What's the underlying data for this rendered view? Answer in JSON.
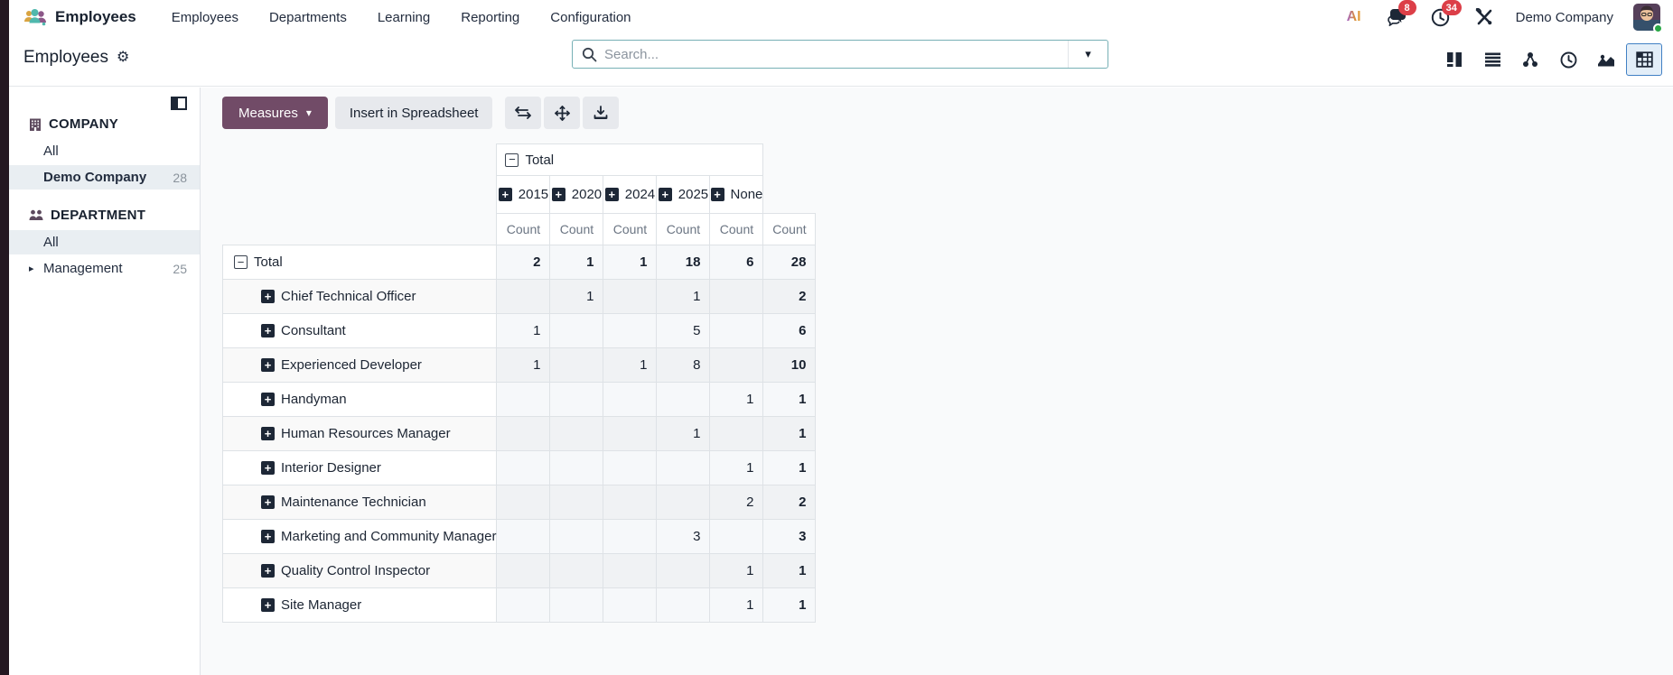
{
  "topbar": {
    "app_name": "Employees",
    "menu_items": [
      "Employees",
      "Departments",
      "Learning",
      "Reporting",
      "Configuration"
    ],
    "systray": {
      "ai_label": "AI",
      "messages_badge": "8",
      "activities_badge": "34",
      "company_name": "Demo Company"
    }
  },
  "control_panel": {
    "breadcrumb_title": "Employees",
    "search": {
      "placeholder": "Search..."
    },
    "view_switcher": [
      {
        "name": "kanban",
        "active": false
      },
      {
        "name": "list",
        "active": false
      },
      {
        "name": "hierarchy",
        "active": false
      },
      {
        "name": "activity",
        "active": false
      },
      {
        "name": "graph",
        "active": false
      },
      {
        "name": "pivot",
        "active": true
      }
    ]
  },
  "sidebar": {
    "company": {
      "title": "COMPANY",
      "items": [
        {
          "label": "All",
          "count": ""
        },
        {
          "label": "Demo Company",
          "count": "28"
        }
      ]
    },
    "department": {
      "title": "DEPARTMENT",
      "items": [
        {
          "label": "All",
          "count": ""
        },
        {
          "label": "Management",
          "count": "25"
        }
      ]
    }
  },
  "toolbar": {
    "measures_label": "Measures",
    "insert_spreadsheet_label": "Insert in Spreadsheet",
    "icons": [
      "flip-axis",
      "expand-all",
      "download"
    ]
  },
  "pivot": {
    "col_group_label": "Total",
    "col_headers": [
      "2015",
      "2020",
      "2024",
      "2025",
      "None"
    ],
    "measure_label": "Count",
    "rows": [
      {
        "label": "Total",
        "values": [
          "2",
          "1",
          "1",
          "18",
          "6",
          "28"
        ]
      },
      {
        "label": "Chief Technical Officer",
        "values": [
          "",
          "1",
          "",
          "1",
          "",
          "2"
        ]
      },
      {
        "label": "Consultant",
        "values": [
          "1",
          "",
          "",
          "5",
          "",
          "6"
        ]
      },
      {
        "label": "Experienced Developer",
        "values": [
          "1",
          "",
          "1",
          "8",
          "",
          "10"
        ]
      },
      {
        "label": "Handyman",
        "values": [
          "",
          "",
          "",
          "",
          "1",
          "1"
        ]
      },
      {
        "label": "Human Resources Manager",
        "values": [
          "",
          "",
          "",
          "1",
          "",
          "1"
        ]
      },
      {
        "label": "Interior Designer",
        "values": [
          "",
          "",
          "",
          "",
          "1",
          "1"
        ]
      },
      {
        "label": "Maintenance Technician",
        "values": [
          "",
          "",
          "",
          "",
          "2",
          "2"
        ]
      },
      {
        "label": "Marketing and Community Manager",
        "values": [
          "",
          "",
          "",
          "3",
          "",
          "3"
        ]
      },
      {
        "label": "Quality Control Inspector",
        "values": [
          "",
          "",
          "",
          "",
          "1",
          "1"
        ]
      },
      {
        "label": "Site Manager",
        "values": [
          "",
          "",
          "",
          "",
          "1",
          "1"
        ]
      }
    ]
  },
  "colors": {
    "primary": "#714B67",
    "badge": "#dc3f48",
    "search_border": "#77b0b5",
    "active_view_border": "#4180c4",
    "sidebar_highlight": "#e9eef2"
  }
}
